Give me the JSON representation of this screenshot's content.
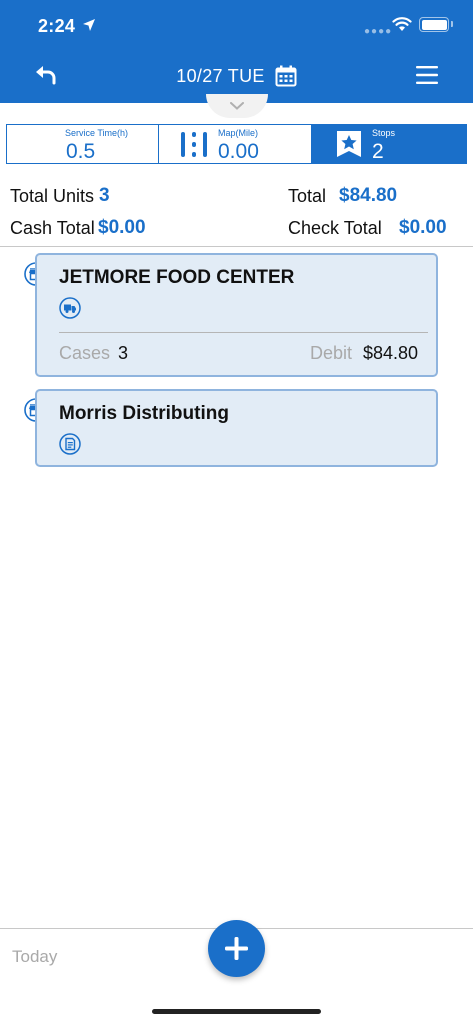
{
  "status_bar": {
    "time": "2:24"
  },
  "header": {
    "date": "10/27 TUE"
  },
  "stats": {
    "service_time": {
      "label": "Service Time(h)",
      "value": "0.5"
    },
    "map": {
      "label": "Map(Mile)",
      "value": "0.00"
    },
    "stops": {
      "label": "Stops",
      "value": "2"
    }
  },
  "totals": {
    "units_label": "Total Units",
    "units_value": "3",
    "total_label": "Total",
    "total_value": "$84.80",
    "cash_label": "Cash Total",
    "cash_value": "$0.00",
    "check_label": "Check Total",
    "check_value": "$0.00"
  },
  "stops_list": [
    {
      "name": "JETMORE FOOD CENTER",
      "cases_label": "Cases",
      "cases_value": "3",
      "debit_label": "Debit",
      "debit_value": "$84.80",
      "sub_icon": "truck-icon"
    },
    {
      "name": "Morris Distributing",
      "sub_icon": "document-icon"
    }
  ],
  "bottom": {
    "today_label": "Today"
  },
  "colors": {
    "primary": "#1a6fc9",
    "card_bg": "#e2ecf6",
    "card_border": "#8fb4de"
  }
}
